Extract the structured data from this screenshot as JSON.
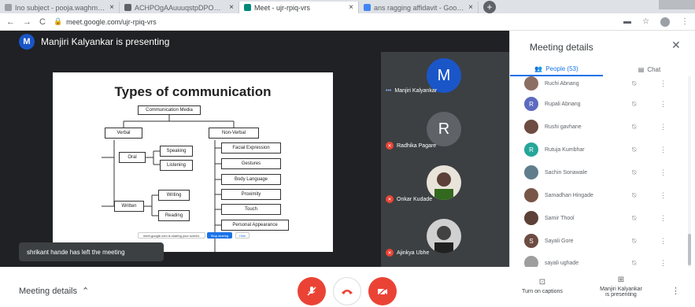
{
  "browser": {
    "tabs": [
      {
        "title": "Ino subject - pooja.waghmare",
        "color": "#5f6368",
        "active": false
      },
      {
        "title": "ACHPOgAAuuuqstpDPOM2sQ",
        "color": "#3c4043",
        "active": false
      },
      {
        "title": "Meet - ujr-rpiq-vrs",
        "color": "#00897b",
        "active": true
      },
      {
        "title": "ans ragging affidavit - Google S",
        "color": "#4285f4",
        "active": false
      }
    ],
    "new_tab_label": "+",
    "url": "meet.google.com/ujr-rpiq-vrs",
    "back_icon": "←",
    "forward_icon": "→",
    "reload_icon": "C"
  },
  "stage": {
    "presenter_initial": "M",
    "presenter_text": "Manjiri Kalyankar is presenting",
    "toast": "shrikant hande has left the meeting"
  },
  "slide": {
    "title": "Types of communication",
    "root": "Communication Media",
    "verbal": "Verbal",
    "nonverbal": "Non-Verbal",
    "oral": "Oral",
    "written": "Written",
    "speaking": "Speaking",
    "listening": "Listening",
    "writing": "Writing",
    "reading": "Reading",
    "nonverbal_items": [
      "Facial Expression",
      "Gestures",
      "Body Language",
      "Proximity",
      "Touch",
      "Personal Appearance"
    ],
    "share_notice": "meet.google.com is sharing your screen.",
    "stop_sharing": "Stop sharing",
    "hide": "Hide"
  },
  "strip": [
    {
      "initial": "M",
      "name": "Manjiri Kalyankar",
      "color": "#1a56c8",
      "muted": false
    },
    {
      "initial": "R",
      "name": "Radhika Pagare",
      "color": "#5f6368",
      "muted": true
    },
    {
      "initial": "",
      "name": "Onkar Kudade",
      "color": "#e9e4da",
      "muted": true
    },
    {
      "initial": "",
      "name": "Ajinkya Ubhe",
      "color": "#d0d0d0",
      "muted": true
    }
  ],
  "panel": {
    "title": "Meeting details",
    "tab_people": "People (53)",
    "tab_chat": "Chat",
    "people": [
      {
        "initial": "",
        "name": "Ruchi Abnang",
        "color": "#8d6e63"
      },
      {
        "initial": "R",
        "name": "Rupali Abnang",
        "color": "#5c6bc0"
      },
      {
        "initial": "",
        "name": "Rushi gavhane",
        "color": "#6d4c41"
      },
      {
        "initial": "R",
        "name": "Rutuja Kumbhar",
        "color": "#26a69a"
      },
      {
        "initial": "",
        "name": "Sachin Sonawale",
        "color": "#607d8b"
      },
      {
        "initial": "",
        "name": "Samadhan Hingade",
        "color": "#795548"
      },
      {
        "initial": "",
        "name": "Samir Thool",
        "color": "#5d4037"
      },
      {
        "initial": "S",
        "name": "Sayali Gore",
        "color": "#6d4c41"
      },
      {
        "initial": "",
        "name": "sayali ughade",
        "color": "#9e9e9e"
      }
    ]
  },
  "bottom": {
    "meeting_details": "Meeting details",
    "captions": "Turn on captions",
    "presenting_line1": "Manjiri Kalyankar",
    "presenting_line2": "is presenting"
  },
  "colors": {
    "red": "#ea4335",
    "blue": "#1a73e8",
    "dark": "#202124"
  }
}
